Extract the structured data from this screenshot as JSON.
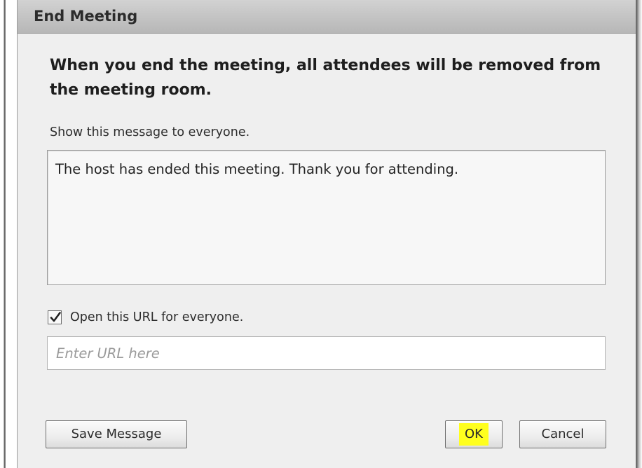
{
  "dialog": {
    "title": "End Meeting",
    "warning": "When you end the meeting, all attendees will be removed from the meeting room.",
    "message_label": "Show this message to everyone.",
    "message_value": "The host has ended this meeting. Thank you for attending.",
    "url_checkbox": {
      "label": "Open this URL for everyone.",
      "checked": true
    },
    "url_input": {
      "value": "",
      "placeholder": "Enter URL here"
    },
    "buttons": {
      "save_label": "Save Message",
      "ok_label": "OK",
      "cancel_label": "Cancel"
    }
  },
  "colors": {
    "ok_highlight": "#ffff1e",
    "titlebar": "#c3c3c3",
    "dialog_background": "#efefef"
  }
}
